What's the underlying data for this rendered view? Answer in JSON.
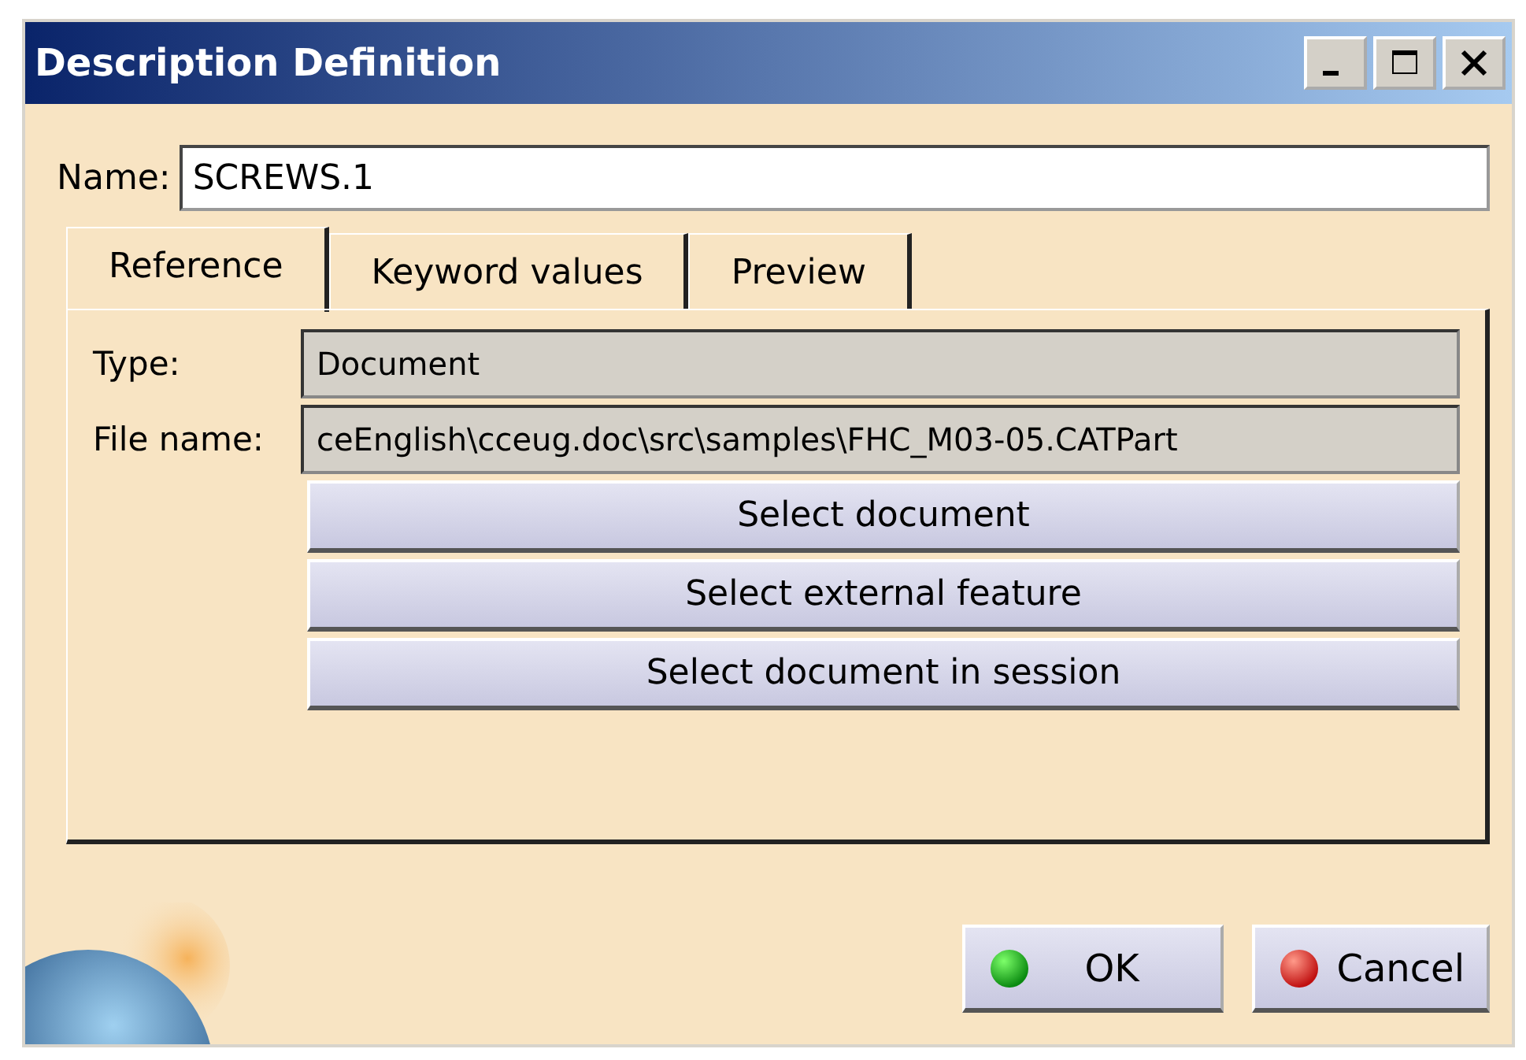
{
  "window": {
    "title": "Description Definition"
  },
  "name_field": {
    "label": "Name:",
    "value": "SCREWS.1"
  },
  "tabs": [
    {
      "label": "Reference",
      "selected": true
    },
    {
      "label": "Keyword values",
      "selected": false
    },
    {
      "label": "Preview",
      "selected": false
    }
  ],
  "reference": {
    "fields": [
      {
        "label": "Type:",
        "value": "Document"
      },
      {
        "label": "File name:",
        "value": "ceEnglish\\cceug.doc\\src\\samples\\FHC_M03-05.CATPart"
      }
    ],
    "buttons": [
      "Select document",
      "Select external feature",
      "Select document in session"
    ]
  },
  "footer_buttons": [
    {
      "label": "OK",
      "kind": "ok"
    },
    {
      "label": "Cancel",
      "kind": "cancel"
    }
  ]
}
